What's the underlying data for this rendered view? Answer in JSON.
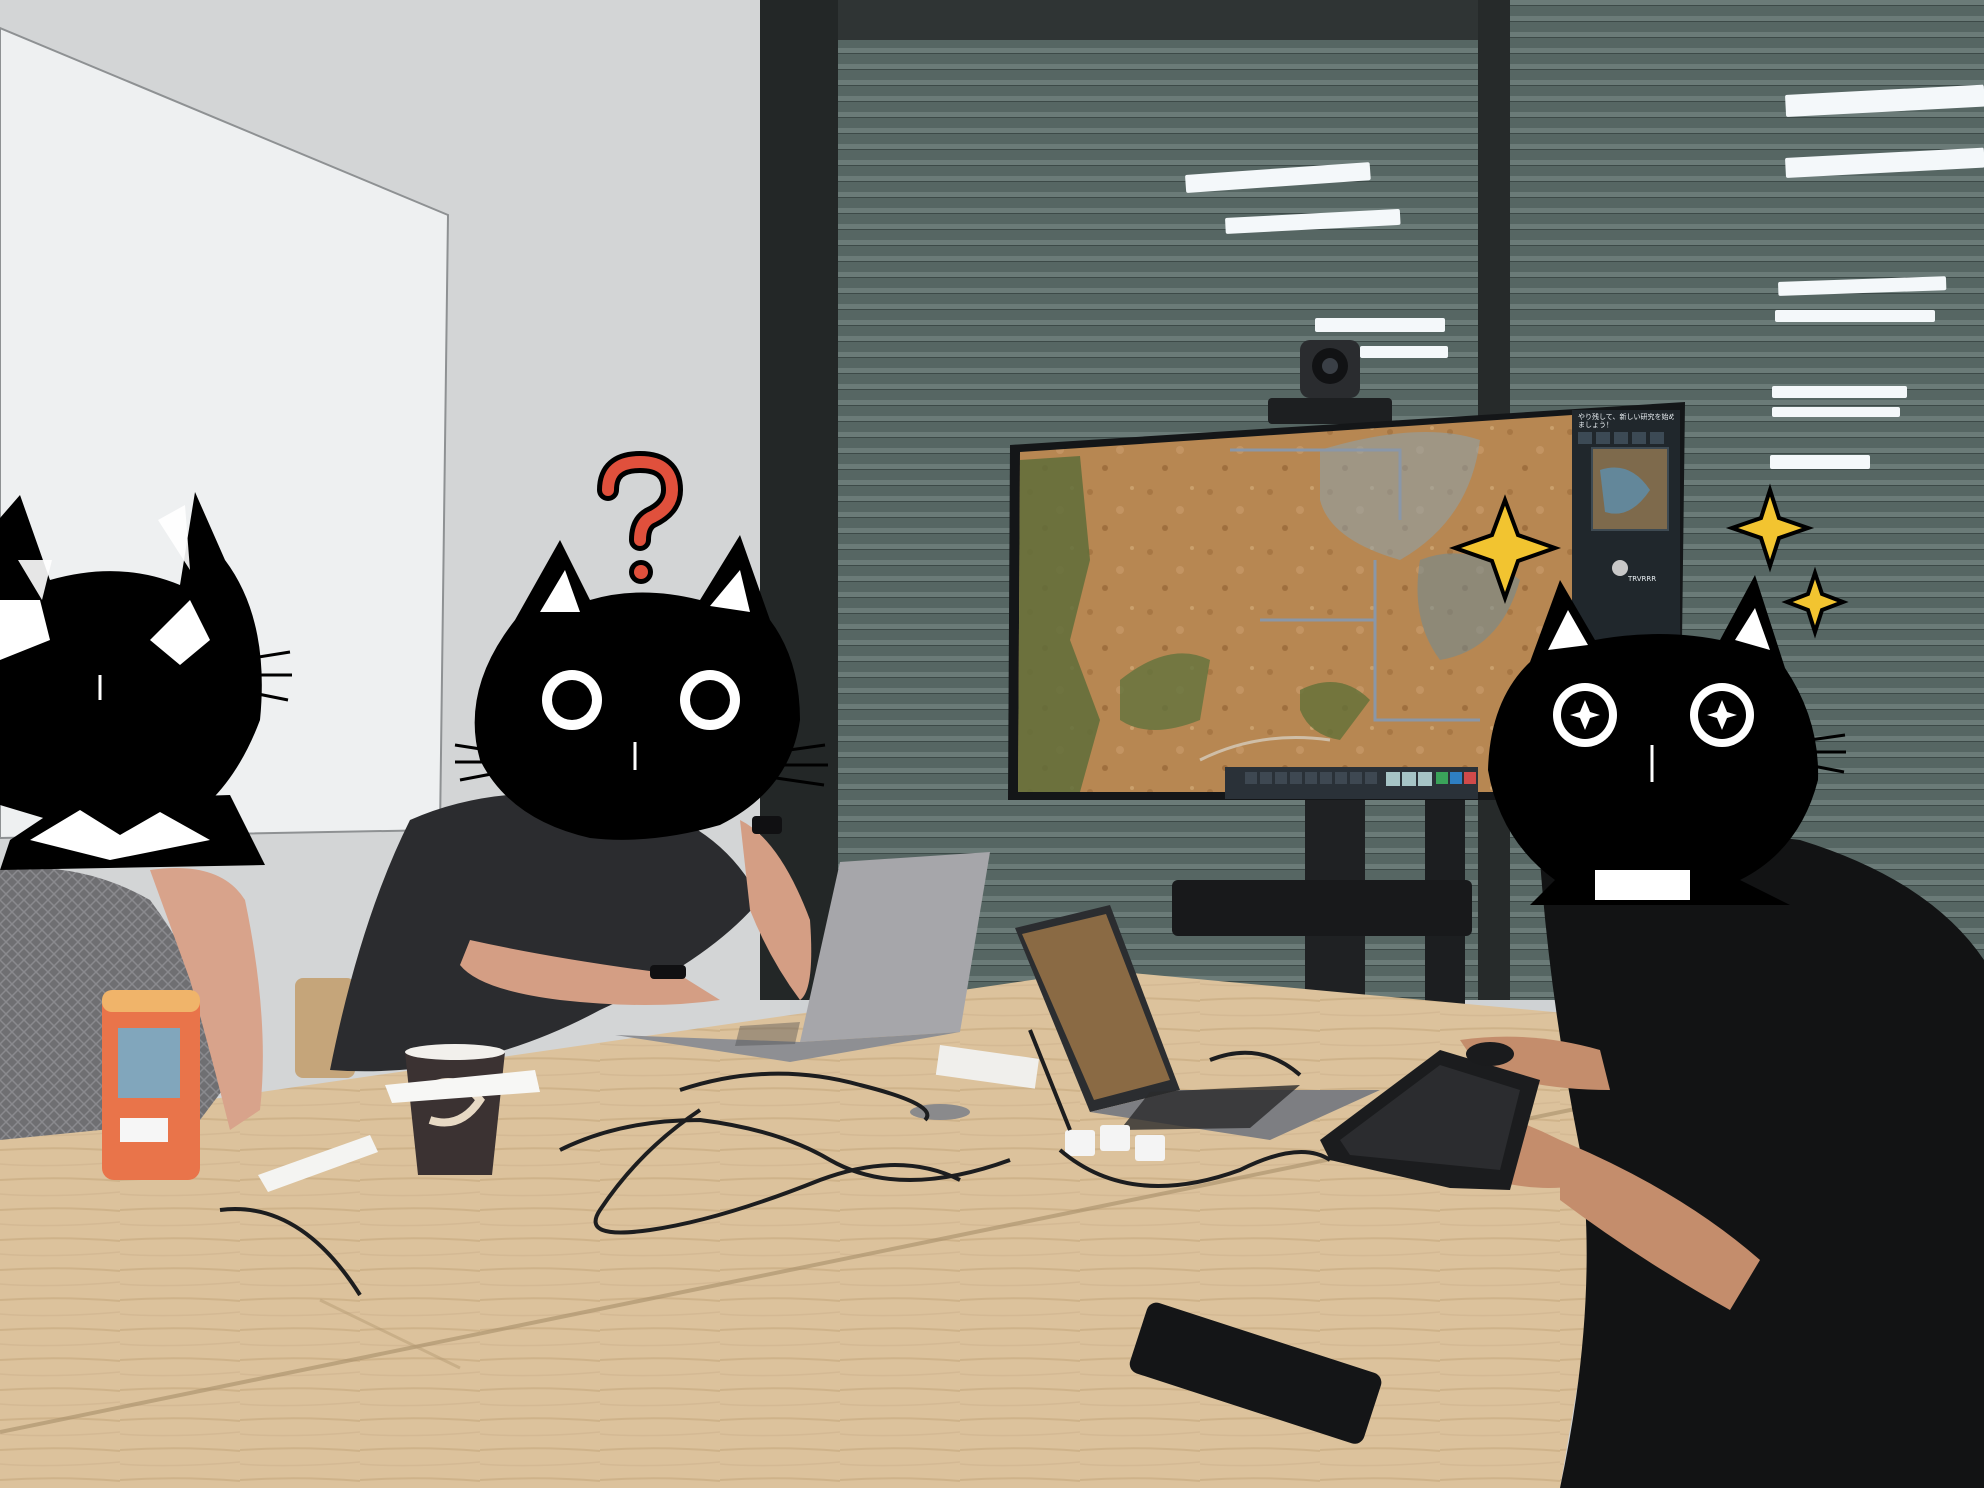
{
  "scene": {
    "colors": {
      "wall": "#d6d7d8",
      "whiteboard": "#eceeef",
      "window_tint": "#4a5a58",
      "table": "#d9bf98",
      "screen_ground": "#b98a55",
      "screen_green": "#5f6e3a",
      "cat": "#000000",
      "question_mark": "#e0503c",
      "sparkle": "#f2c430"
    },
    "icons": {
      "left_cat": "cat-face-sketch-icon",
      "middle_cat": "cat-face-confused-icon",
      "right_cat": "cat-face-sparkly-icon",
      "question": "question-mark-icon",
      "sparkle": "sparkle-star-icon"
    }
  },
  "game_ui": {
    "hint_text": "やり残して、新しい研究を始め\nましょう！",
    "panel_caption": "TRVRRR"
  }
}
